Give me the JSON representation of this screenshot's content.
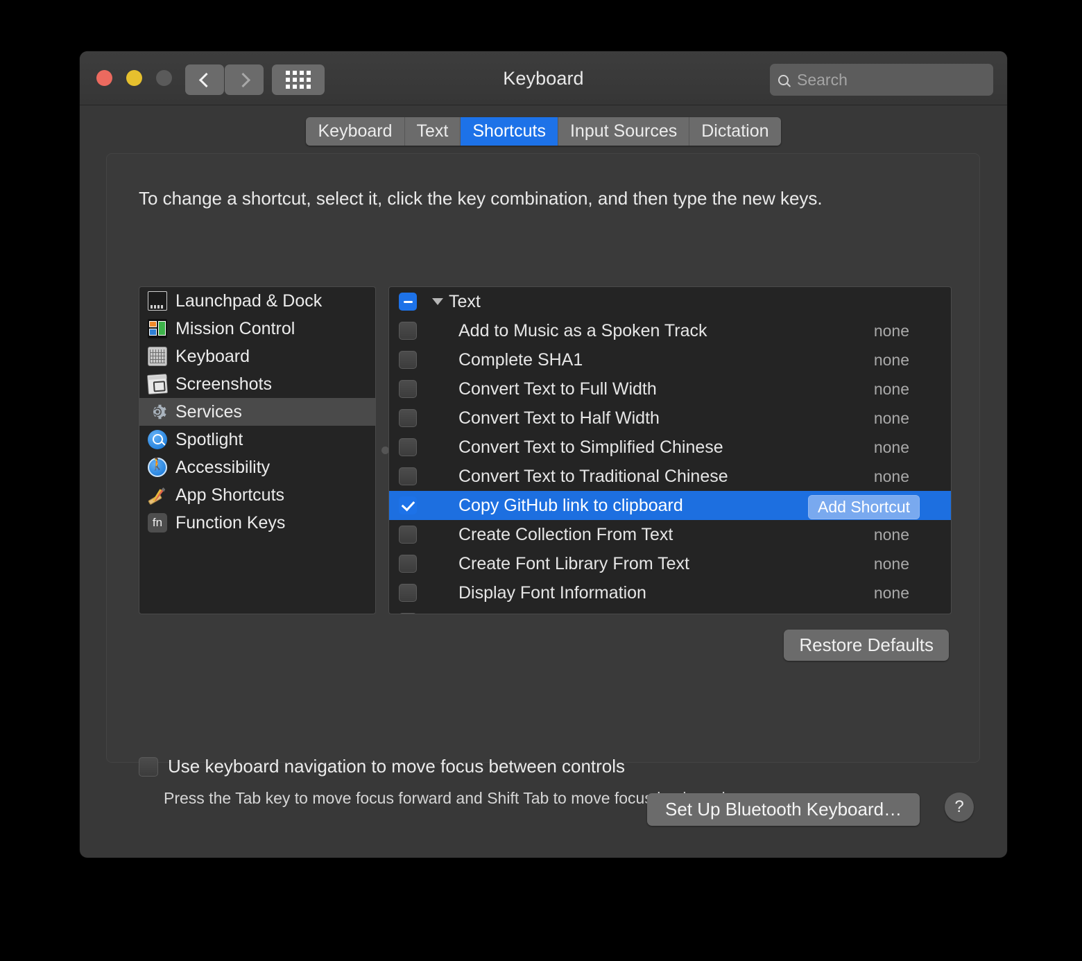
{
  "window": {
    "title": "Keyboard",
    "traffic_lights": [
      "close",
      "minimize",
      "zoom"
    ],
    "nav": {
      "back": "back-arrow",
      "forward": "forward-arrow",
      "grid": "show-all-grid"
    },
    "search": {
      "value": "",
      "placeholder": "Search"
    }
  },
  "tabs": [
    {
      "label": "Keyboard",
      "active": false
    },
    {
      "label": "Text",
      "active": false
    },
    {
      "label": "Shortcuts",
      "active": true
    },
    {
      "label": "Input Sources",
      "active": false
    },
    {
      "label": "Dictation",
      "active": false
    }
  ],
  "main": {
    "hint": "To change a shortcut, select it, click the key combination, and then type the new keys.",
    "restore_defaults": "Restore Defaults",
    "keyboard_nav_label": "Use keyboard navigation to move focus between controls",
    "keyboard_nav_note": "Press the Tab key to move focus forward and Shift Tab to move focus backward.",
    "keyboard_nav_checked": false
  },
  "sidebar": {
    "items": [
      {
        "label": "Launchpad & Dock",
        "icon": "launchpad-dock-icon",
        "selected": false
      },
      {
        "label": "Mission Control",
        "icon": "mission-control-icon",
        "selected": false
      },
      {
        "label": "Keyboard",
        "icon": "keyboard-icon",
        "selected": false
      },
      {
        "label": "Screenshots",
        "icon": "screenshots-icon",
        "selected": false
      },
      {
        "label": "Services",
        "icon": "gear-icon",
        "selected": true
      },
      {
        "label": "Spotlight",
        "icon": "spotlight-icon",
        "selected": false
      },
      {
        "label": "Accessibility",
        "icon": "accessibility-icon",
        "selected": false
      },
      {
        "label": "App Shortcuts",
        "icon": "app-shortcuts-icon",
        "selected": false
      },
      {
        "label": "Function Keys",
        "icon": "fn-key-icon",
        "selected": false
      }
    ]
  },
  "shortcut_list": {
    "group": {
      "label": "Text",
      "checkbox_state": "mixed",
      "expanded": true
    },
    "rows": [
      {
        "name": "Add to Music as a Spoken Track",
        "value": "none",
        "checked": false,
        "selected": false
      },
      {
        "name": "Complete SHA1",
        "value": "none",
        "checked": false,
        "selected": false
      },
      {
        "name": "Convert Text to Full Width",
        "value": "none",
        "checked": false,
        "selected": false
      },
      {
        "name": "Convert Text to Half Width",
        "value": "none",
        "checked": false,
        "selected": false
      },
      {
        "name": "Convert Text to Simplified Chinese",
        "value": "none",
        "checked": false,
        "selected": false
      },
      {
        "name": "Convert Text to Traditional Chinese",
        "value": "none",
        "checked": false,
        "selected": false
      },
      {
        "name": "Copy GitHub link to clipboard",
        "value": "Add Shortcut",
        "checked": true,
        "selected": true
      },
      {
        "name": "Create Collection From Text",
        "value": "none",
        "checked": false,
        "selected": false
      },
      {
        "name": "Create Font Library From Text",
        "value": "none",
        "checked": false,
        "selected": false
      },
      {
        "name": "Display Font Information",
        "value": "none",
        "checked": false,
        "selected": false
      }
    ]
  },
  "footer": {
    "bluetooth_button": "Set Up Bluetooth Keyboard…",
    "help_button": "?"
  },
  "colors": {
    "accent_blue": "#1d72e8",
    "selection_blue": "#1d6fe0",
    "window_bg": "#383838",
    "panel_bg": "#3a3a3a",
    "list_bg": "#242424"
  }
}
